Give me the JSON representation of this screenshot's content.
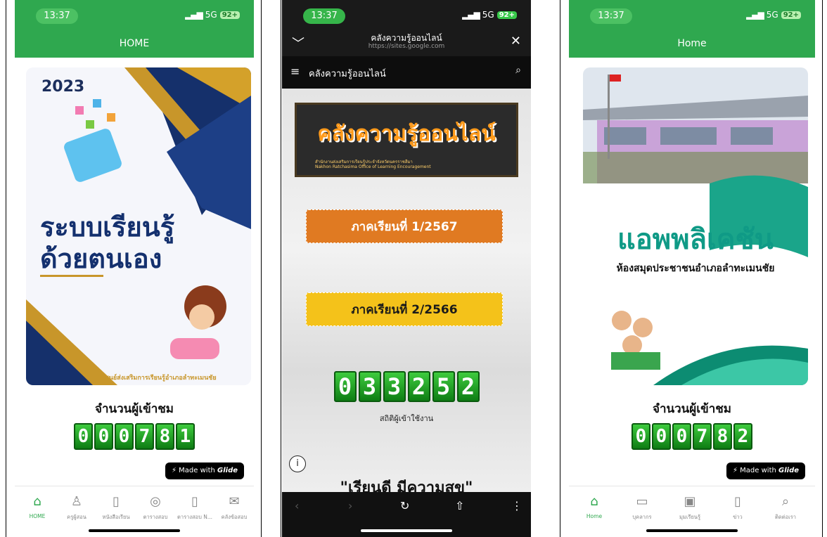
{
  "frames": [
    {
      "status": {
        "time": "13:37",
        "network": "5G",
        "battery": "92+"
      },
      "appbar_title": "HOME",
      "hero": {
        "year": "2023",
        "headline_line1": "ระบบเรียนรู้",
        "headline_line2": "ด้วยตนเอง",
        "caption": "ศูนย์ส่งเสริมการเรียนรู้อำเภอลำทะเมนชัย"
      },
      "counter_title": "จำนวนผู้เข้าชม",
      "counter_digits": [
        "0",
        "0",
        "0",
        "7",
        "8",
        "1"
      ],
      "badge": {
        "prefix": "Made with",
        "brand": "Glide"
      },
      "tabs": [
        {
          "icon": "⌂",
          "label": "HOME",
          "active": true
        },
        {
          "icon": "♙",
          "label": "ครูผู้สอน"
        },
        {
          "icon": "▯",
          "label": "หนังสือเรียน"
        },
        {
          "icon": "◎",
          "label": "ตารางสอบ"
        },
        {
          "icon": "▯",
          "label": "ตารางสอบ N..."
        },
        {
          "icon": "✉",
          "label": "คลังข้อสอบ"
        }
      ]
    },
    {
      "status": {
        "time": "13:37",
        "network": "5G",
        "battery": "92+"
      },
      "browser": {
        "title": "คลังความรู้ออนไลน์",
        "url": "https://sites.google.com",
        "chevron": "﹀",
        "close": "✕"
      },
      "site": {
        "name": "คลังความรู้ออนไลน์",
        "menu": "≡",
        "search": "⌕"
      },
      "banner": {
        "headline": "คลังความรู้ออนไลน์",
        "sub1": "สำนักงานส่งเสริมการเรียนรู้ประจำจังหวัดนครราชสีมา",
        "sub2": "Nakhon Ratchasima Office of Learning Encouragement"
      },
      "semesters": [
        "ภาคเรียนที่ 1/2567",
        "ภาคเรียนที่ 2/2566"
      ],
      "counter_digits": [
        "0",
        "3",
        "3",
        "2",
        "5",
        "2"
      ],
      "stat_label": "สถิติผู้เข้าใช้งาน",
      "info_icon": "i",
      "bottom_quote": "\"เรียนดี มีความสุข\"",
      "nav": {
        "back": "‹",
        "forward": "›",
        "reload": "↻",
        "share": "⇧",
        "more": "⋮"
      }
    },
    {
      "status": {
        "time": "13:37",
        "network": "5G",
        "battery": "92+"
      },
      "appbar_title": "Home",
      "hero": {
        "headline": "แอพพลิเคชัน",
        "sub": "ห้องสมุดประชาชนอำเภอลำทะเมนชัย"
      },
      "counter_title": "จำนวนผู้เข้าชม",
      "counter_digits": [
        "0",
        "0",
        "0",
        "7",
        "8",
        "2"
      ],
      "badge": {
        "prefix": "Made with",
        "brand": "Glide"
      },
      "tabs": [
        {
          "icon": "⌂",
          "label": "Home",
          "active": true
        },
        {
          "icon": "▭",
          "label": "บุคลากร"
        },
        {
          "icon": "▣",
          "label": "มุมเรียนรู้"
        },
        {
          "icon": "▯",
          "label": "ข่าว"
        },
        {
          "icon": "⌕",
          "label": "ติดต่อเรา"
        }
      ]
    }
  ]
}
